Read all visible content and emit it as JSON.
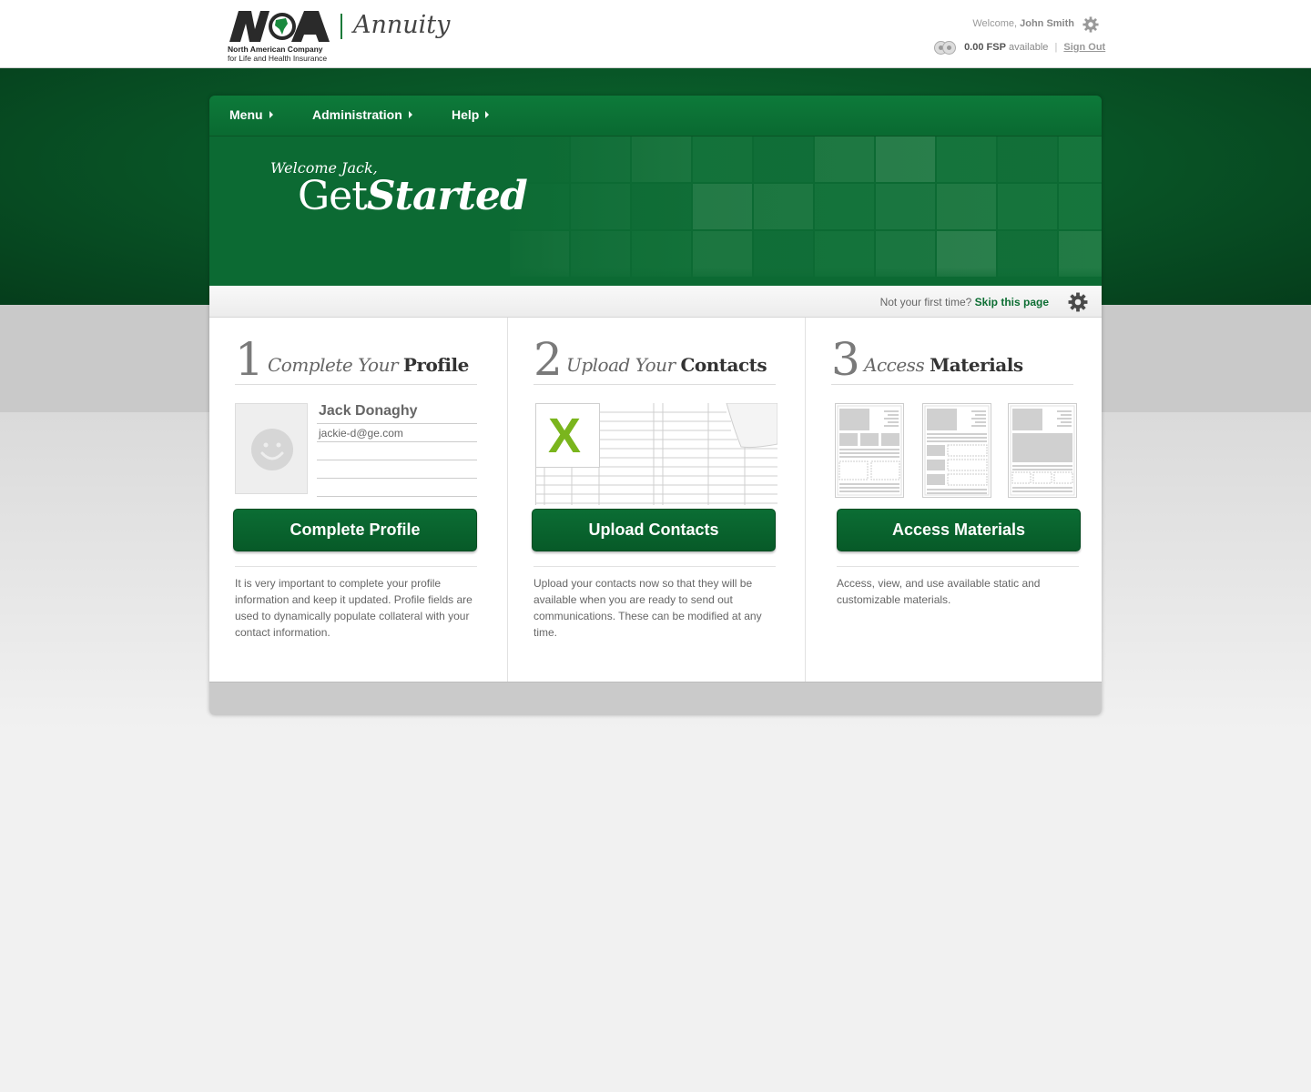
{
  "header": {
    "logo_line1": "North American Company",
    "logo_line2": "for Life and Health Insurance",
    "product": "Annuity",
    "welcome_prefix": "Welcome,",
    "user_name": "John Smith",
    "fsp_amount": "0.00 FSP",
    "fsp_suffix": "available",
    "separator": "|",
    "sign_out": "Sign Out"
  },
  "nav": [
    {
      "label": "Menu"
    },
    {
      "label": "Administration"
    },
    {
      "label": "Help"
    }
  ],
  "hero": {
    "welcome": "Welcome Jack,",
    "get": "Get",
    "started": "Started"
  },
  "subbar": {
    "question": "Not your first time?",
    "skip": "Skip this page"
  },
  "steps": [
    {
      "number": "1",
      "title_italic": "Complete Your",
      "title_bold": "Profile",
      "button": "Complete Profile",
      "description": "It is very important to complete your profile information and keep it updated. Profile fields are used to dynamically populate collateral with your contact information."
    },
    {
      "number": "2",
      "title_italic": "Upload Your",
      "title_bold": "Contacts",
      "button": "Upload Contacts",
      "description": "Upload your contacts now so that they will be available when you are ready to send out communications. These can be modified at any time."
    },
    {
      "number": "3",
      "title_italic": "Access",
      "title_bold": "Materials",
      "button": "Access Materials",
      "description": "Access, view, and use available static and customizable materials."
    }
  ],
  "profile": {
    "name": "Jack Donaghy",
    "email": "jackie-d@ge.com"
  },
  "spreadsheet_glyph": "X",
  "colors": {
    "brand_green": "#0b6d34",
    "excel_green": "#7ab51d"
  }
}
